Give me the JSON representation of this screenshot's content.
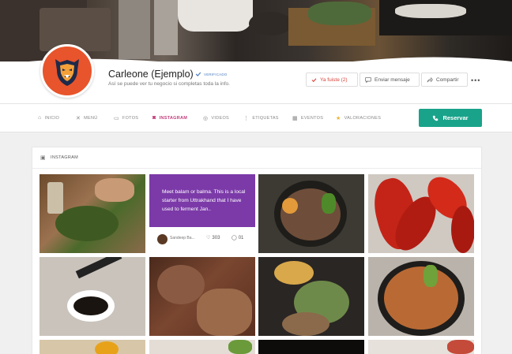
{
  "business": {
    "name": "Carleone (Ejemplo)",
    "verified_label": "VERIFICADO",
    "subtitle": "Así se puede ver tu negocio si completas toda la info."
  },
  "actions": {
    "visited": "Ya fuiste (2)",
    "message": "Enviar mensaje",
    "share": "Compartir",
    "more": "•••"
  },
  "tabs": [
    {
      "label": "INICIO",
      "icon": "home-icon",
      "active": false
    },
    {
      "label": "MENÚ",
      "icon": "utensils-icon",
      "active": false
    },
    {
      "label": "FOTOS",
      "icon": "image-icon",
      "active": false
    },
    {
      "label": "INSTAGRAM",
      "icon": "instagram-icon",
      "active": true
    },
    {
      "label": "VIDEOS",
      "icon": "video-icon",
      "active": false
    },
    {
      "label": "ETIQUETAS",
      "icon": "tag-icon",
      "active": false
    },
    {
      "label": "EVENTOS",
      "icon": "calendar-icon",
      "active": false
    },
    {
      "label": "VALORACIONES",
      "icon": "star-icon",
      "active": false
    }
  ],
  "reserve_label": "Reservar",
  "section": {
    "title": "INSTAGRAM"
  },
  "featured_post": {
    "caption": "Meet balam or balma. This is a local starter from Uttrakhand that I have used to ferment Jan..",
    "username": "Sandeep Ba...",
    "likes": "303",
    "comments": "01"
  },
  "colors": {
    "accent": "#19a38a",
    "active_tab": "#c23c7c",
    "visited": "#d8443a",
    "avatar_bg": "#e8542b",
    "post_bg": "#7b3aa8"
  }
}
